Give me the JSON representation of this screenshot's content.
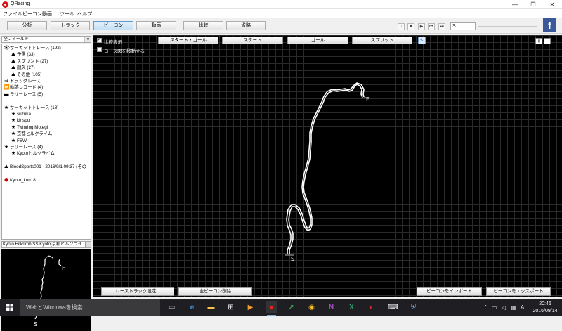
{
  "window": {
    "title": "QRacing",
    "minimize": "—",
    "maximize": "❐",
    "close": "✕"
  },
  "menu": [
    "ファイル",
    "ビーコン",
    "動画",
    "ツール",
    "ヘルプ"
  ],
  "toolbar": {
    "tabs": [
      "分析",
      "トラック",
      "ビーコン",
      "動画",
      "比較",
      "省略"
    ],
    "active_tab": "ビーコン",
    "media": [
      "↓",
      "■",
      "▶",
      "⏮",
      "⏭"
    ],
    "speed": "S"
  },
  "left": {
    "field_select": "全フィールド",
    "tree": [
      {
        "icon": "👁",
        "text": "サーキットトレース (192)",
        "indent": 0,
        "red": false
      },
      {
        "icon": "⛰",
        "text": "予選 (33)",
        "indent": 2,
        "red": false
      },
      {
        "icon": "⛰",
        "text": "スプリント (27)",
        "indent": 2,
        "red": false
      },
      {
        "icon": "⛰",
        "text": "耐久 (27)",
        "indent": 2,
        "red": false
      },
      {
        "icon": "⛰",
        "text": "その他 (105)",
        "indent": 2,
        "red": false
      },
      {
        "icon": "⇒",
        "text": "ドラッグレース",
        "indent": 0,
        "red": false
      },
      {
        "icon": "⏩",
        "text": "軌跡レコード (4)",
        "indent": 0,
        "red": false
      },
      {
        "icon": "▬",
        "text": "ラリーレース (5)",
        "indent": 0,
        "red": false
      },
      {
        "icon": "",
        "text": "",
        "indent": 0,
        "red": false
      },
      {
        "icon": "★",
        "text": "サーキットトレース (18)",
        "indent": 0,
        "red": false
      },
      {
        "icon": "★",
        "text": "suzuka",
        "indent": 2,
        "red": false
      },
      {
        "icon": "★",
        "text": "kinspo",
        "indent": 2,
        "red": false
      },
      {
        "icon": "★",
        "text": "Twinring Motegi",
        "indent": 2,
        "red": false
      },
      {
        "icon": "★",
        "text": "京都ヒルクライム",
        "indent": 2,
        "red": false
      },
      {
        "icon": "★",
        "text": "FSW",
        "indent": 2,
        "red": false
      },
      {
        "icon": "★",
        "text": "ラリーレース (4)",
        "indent": 0,
        "red": false
      },
      {
        "icon": "★",
        "text": "Kyotoヒルクライム",
        "indent": 2,
        "red": false
      },
      {
        "icon": "",
        "text": "",
        "indent": 0,
        "red": false
      },
      {
        "icon": "⛰",
        "text": "BloodSports001 - 2016/9/1 09:37 (その",
        "indent": 0,
        "red": false
      },
      {
        "icon": "",
        "text": "",
        "indent": 0,
        "red": false
      },
      {
        "icon": "⬢",
        "text": "Kyoto_kun18",
        "indent": 0,
        "red": true
      }
    ],
    "map_header": "Kyoto Hillclimb SS Kyoto[京都ヒルクライ",
    "map_labels": {
      "finish": "F",
      "start": "S"
    }
  },
  "main": {
    "checkbox_compare": {
      "label": "比較表示",
      "checked": true
    },
    "checkbox_move": {
      "label": "コース図を移動する",
      "checked": false
    },
    "top_buttons": [
      "スタート・ゴール",
      "スタート",
      "ゴール",
      "スプリット"
    ],
    "zoom_in": "+",
    "zoom_out": "−",
    "track_labels": {
      "finish": "F",
      "start": "S"
    },
    "bottom_buttons": [
      "レーストラック設定...",
      "全ビーコン削除",
      "ビーコンをインポート",
      "ビーコンをエクスポート"
    ]
  },
  "taskbar": {
    "search_placeholder": "WebとWindowsを検索",
    "apps": [
      "task-view-icon",
      "edge-icon",
      "file-explorer-icon",
      "store-icon",
      "media-player-icon",
      "qracing-icon",
      "chart-app-icon",
      "chrome-icon",
      "onenote-icon",
      "excel-icon",
      "acrobat-icon",
      "keyboard-app-icon",
      "shield-app-icon"
    ],
    "time": "20:46",
    "date": "2016/09/14"
  }
}
